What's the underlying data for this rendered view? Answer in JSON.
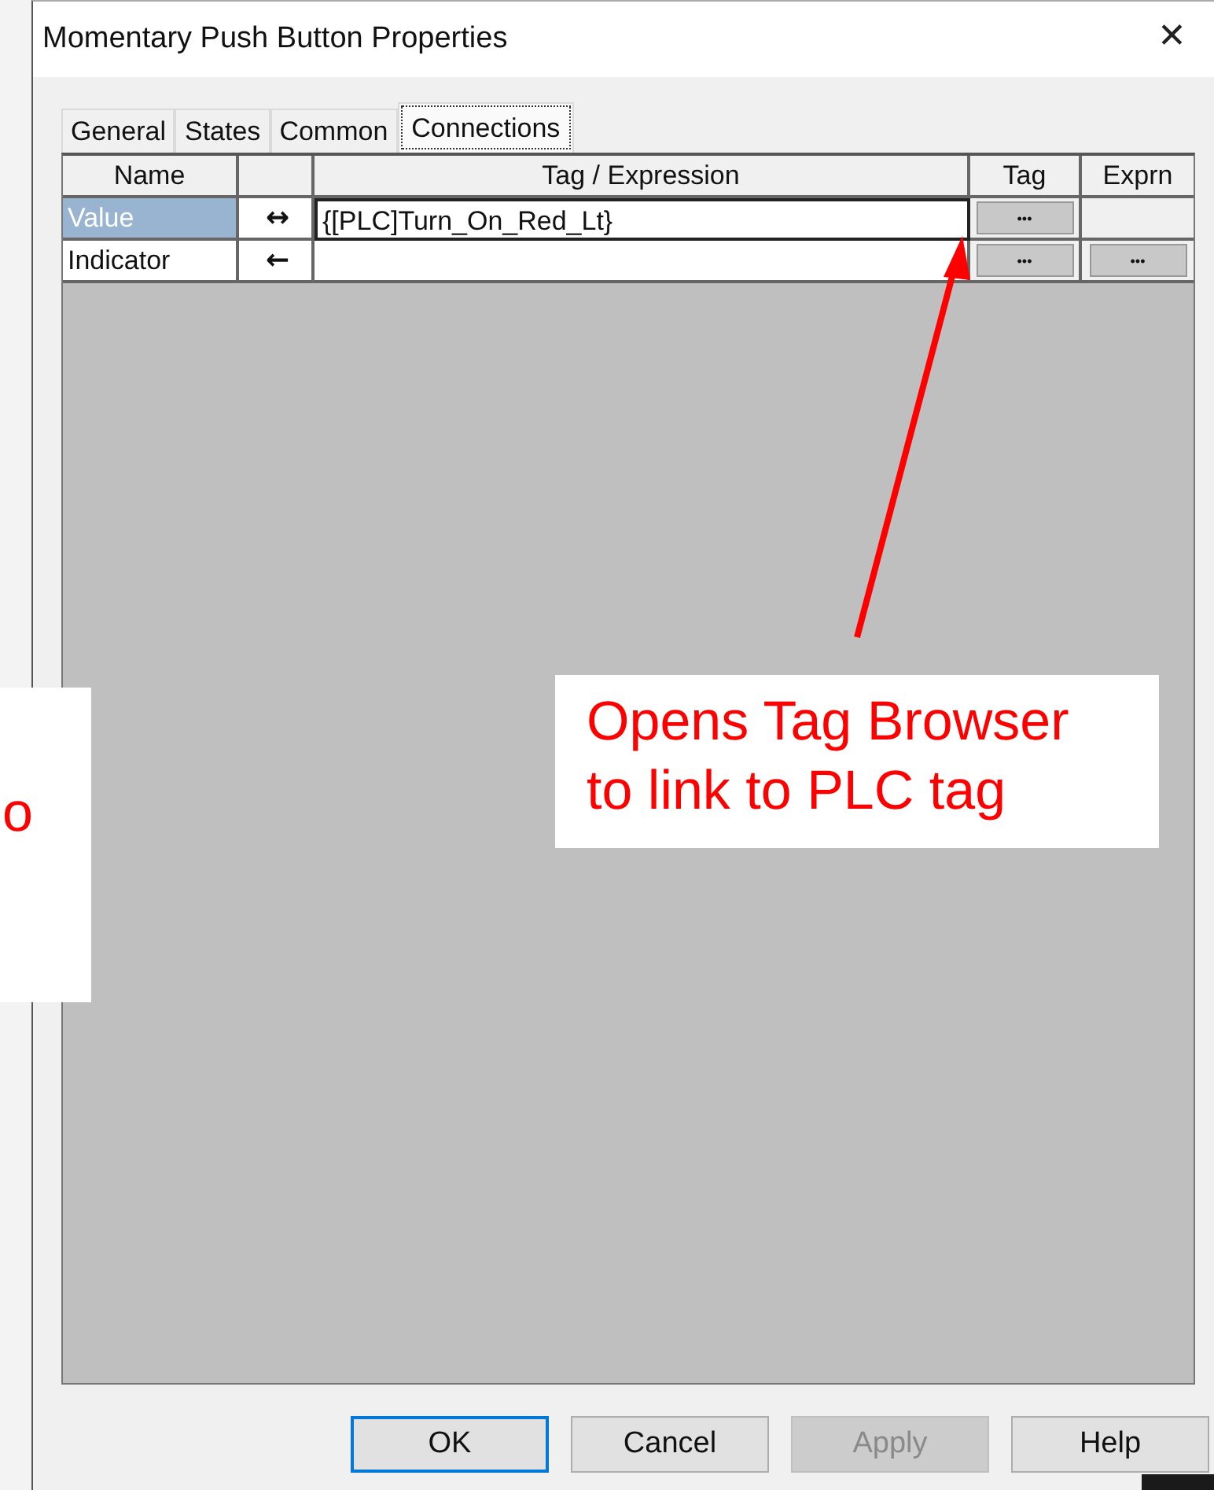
{
  "window": {
    "title": "Momentary Push Button Properties",
    "close": "✕"
  },
  "tabs": [
    {
      "label": "General",
      "selected": false
    },
    {
      "label": "States",
      "selected": false
    },
    {
      "label": "Common",
      "selected": false
    },
    {
      "label": "Connections",
      "selected": true
    }
  ],
  "grid": {
    "columns": [
      "Name",
      "",
      "Tag / Expression",
      "Tag",
      "Exprn"
    ],
    "rows": [
      {
        "name": "Value",
        "direction": "↔",
        "expression": "{[PLC]Turn_On_Red_Lt}",
        "tag_button": "•••",
        "selected": true
      },
      {
        "name": "Indicator",
        "direction": "←",
        "expression": "",
        "tag_button": "•••",
        "exprn_button": "•••",
        "selected": false
      }
    ]
  },
  "buttons": [
    {
      "label": "OK",
      "default": true,
      "disabled": false
    },
    {
      "label": "Cancel",
      "default": false,
      "disabled": false
    },
    {
      "label": "Apply",
      "default": false,
      "disabled": true
    },
    {
      "label": "Help",
      "default": false,
      "disabled": false
    }
  ],
  "callouts": [
    {
      "text": "o",
      "kind": "left"
    },
    {
      "text": "Opens Tag Browser to link to PLC tag",
      "kind": "right"
    }
  ]
}
